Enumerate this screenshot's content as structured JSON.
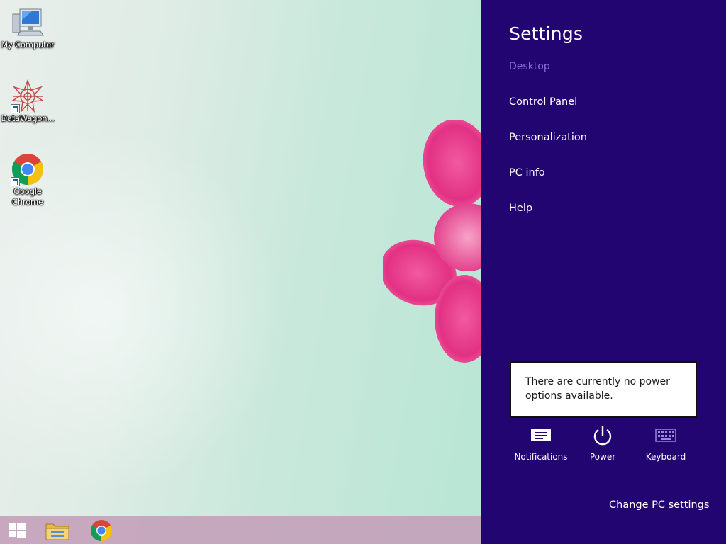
{
  "desktop": {
    "icons": [
      {
        "label": "My Computer",
        "icon": "my-computer-icon"
      },
      {
        "label": "DataWagon...",
        "icon": "datawagon-icon"
      },
      {
        "label": "Google Chrome",
        "icon": "chrome-icon"
      }
    ]
  },
  "taskbar": {
    "items": [
      {
        "icon": "windows-start-icon"
      },
      {
        "icon": "file-explorer-icon"
      },
      {
        "icon": "chrome-icon"
      }
    ]
  },
  "settings_charm": {
    "title": "Settings",
    "context": "Desktop",
    "items": [
      {
        "label": "Control Panel"
      },
      {
        "label": "Personalization"
      },
      {
        "label": "PC info"
      },
      {
        "label": "Help"
      }
    ],
    "power_message": "There are currently no power options available.",
    "quick_actions": [
      {
        "label": "Notifications",
        "icon": "notifications-icon"
      },
      {
        "label": "Power",
        "icon": "power-icon"
      },
      {
        "label": "Keyboard",
        "icon": "keyboard-icon"
      }
    ],
    "change_pc_settings": "Change PC settings"
  },
  "colors": {
    "charm_background": "#230572",
    "charm_context_text": "#8a6fd9",
    "taskbar_tint": "#c49eb8",
    "flower_pink": "#e8358a"
  }
}
